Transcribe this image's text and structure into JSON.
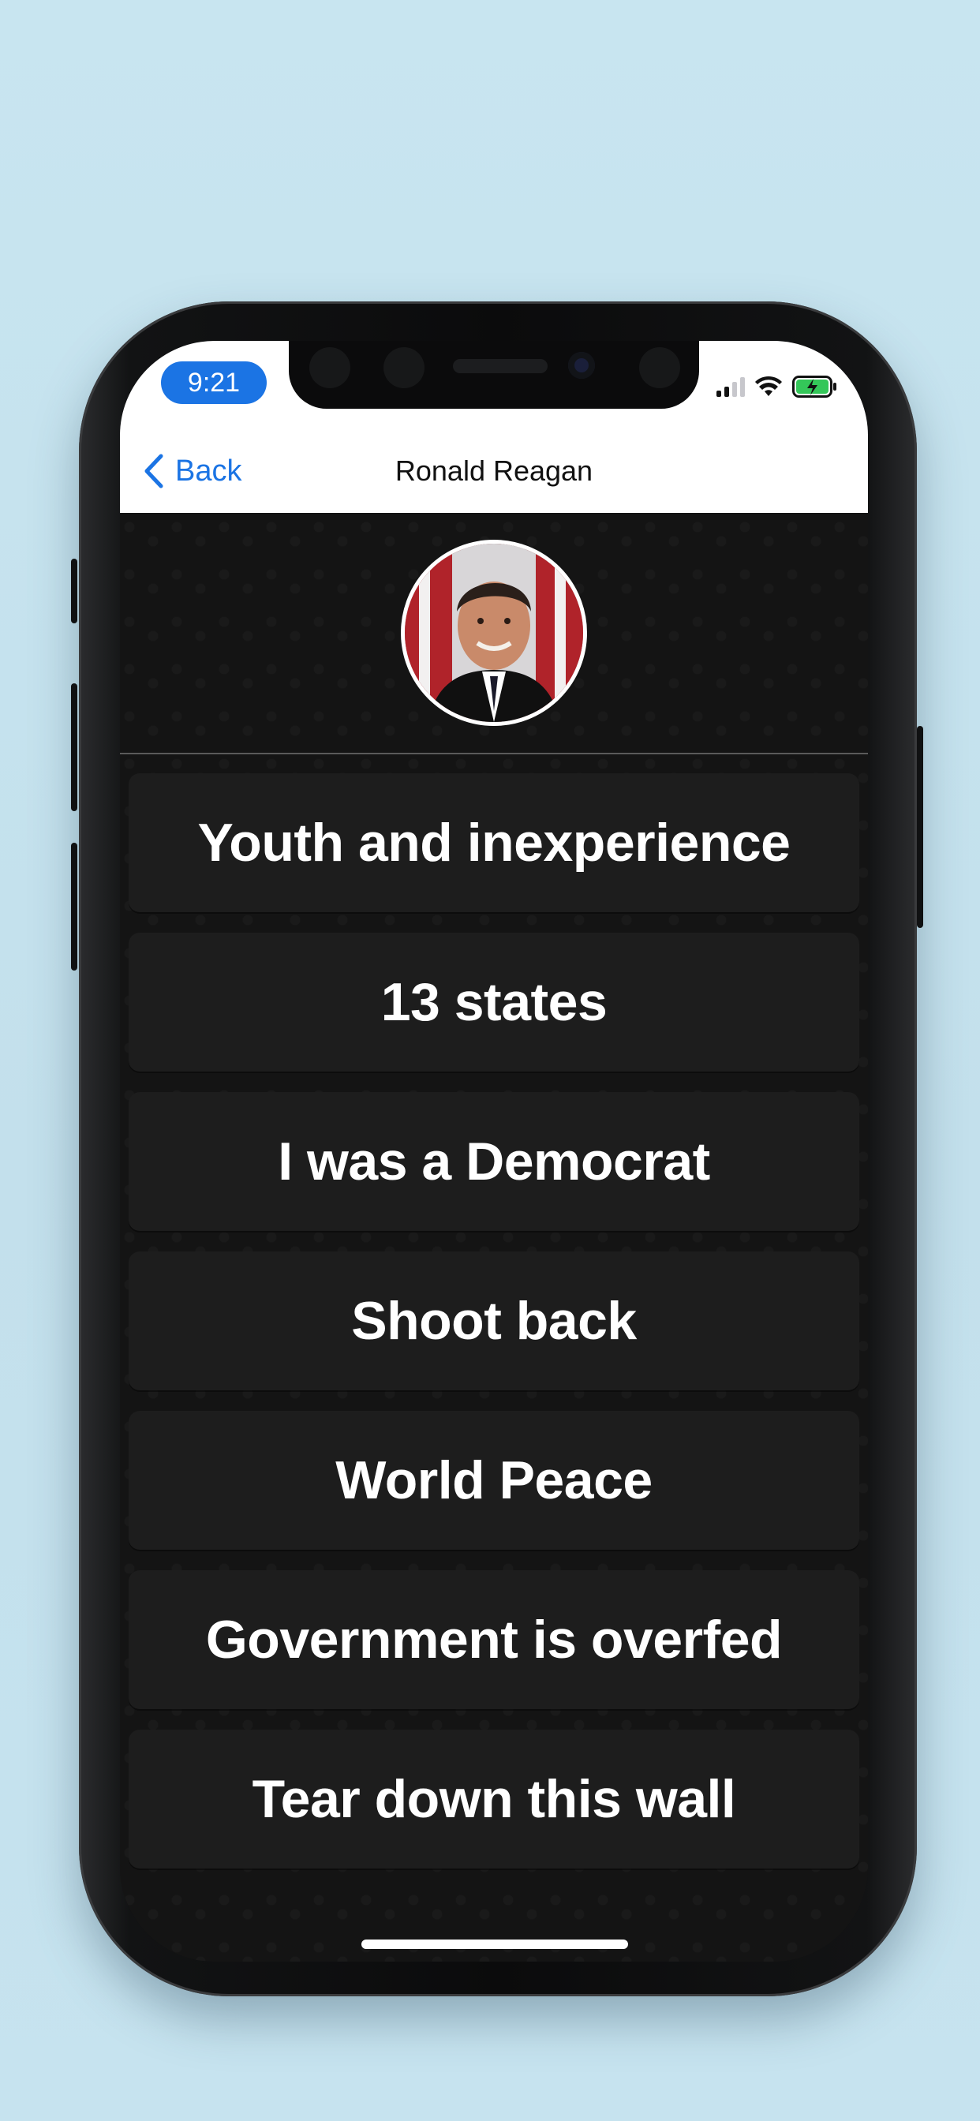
{
  "status_bar": {
    "time": "9:21"
  },
  "nav": {
    "back_label": "Back",
    "title": "Ronald Reagan"
  },
  "profile": {
    "avatar_icon": "portrait-avatar"
  },
  "answers": [
    {
      "label": "Youth and inexperience"
    },
    {
      "label": "13 states"
    },
    {
      "label": "I was a Democrat"
    },
    {
      "label": "Shoot back"
    },
    {
      "label": "World Peace"
    },
    {
      "label": "Government is overfed"
    },
    {
      "label": "Tear down this wall"
    }
  ],
  "colors": {
    "accent": "#1b74e4",
    "background": "#c6e3ef",
    "card": "#1d1d1d",
    "screen": "#141414",
    "battery": "#34c759"
  }
}
